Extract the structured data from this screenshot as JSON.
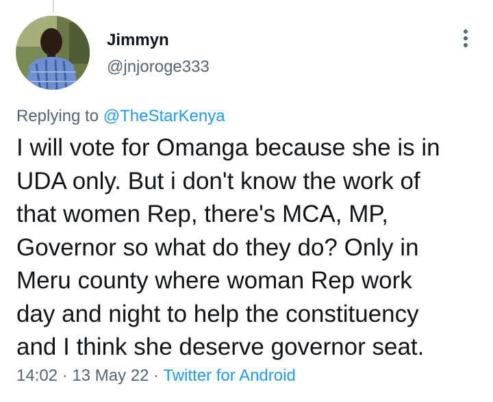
{
  "author": {
    "name": "Jimmyn",
    "handle": "@jnjoroge333"
  },
  "reply": {
    "prefix": "Replying to",
    "mention": "@TheStarKenya"
  },
  "tweet_lines": [
    "I will vote for Omanga because she is in",
    "UDA only. But i don't know the work of",
    "that women Rep, there's MCA, MP,",
    "Governor so what do they do? Only in",
    "Meru county where woman Rep work",
    "day and night to help the constituency",
    "and I think she deserve governor seat."
  ],
  "meta": {
    "time": "14:02",
    "sep1": " · ",
    "date": "13 May 22",
    "sep2": " · ",
    "source": "Twitter for Android"
  },
  "icons": {
    "more": "more-vertical-icon"
  },
  "colors": {
    "text": "#0f1419",
    "secondary": "#536471",
    "link": "#1d9bf0",
    "thread_line": "#cfd9de"
  }
}
